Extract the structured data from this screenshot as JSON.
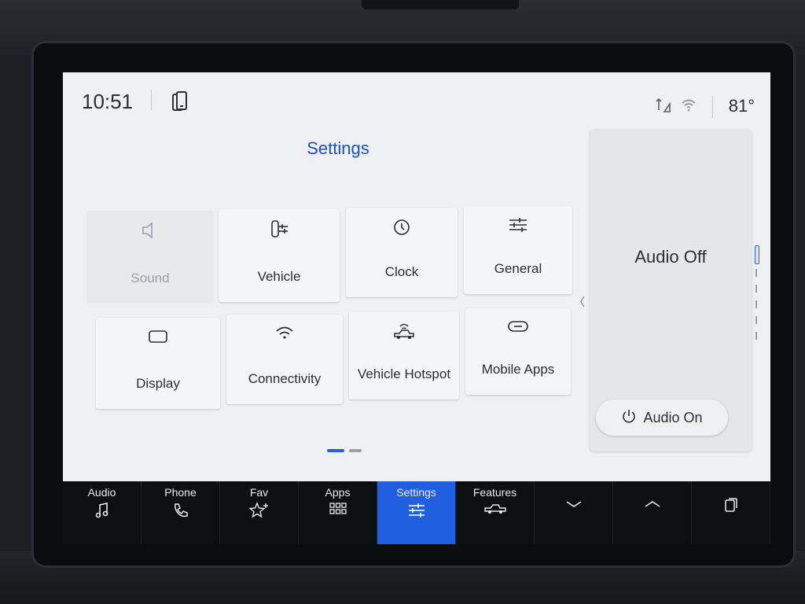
{
  "status": {
    "time": "10:51",
    "temperature": "81°"
  },
  "header": {
    "title": "Settings"
  },
  "tiles": [
    {
      "label": "Sound",
      "icon": "speaker-icon",
      "enabled": false
    },
    {
      "label": "Vehicle",
      "icon": "vehicle-settings-icon",
      "enabled": true
    },
    {
      "label": "Clock",
      "icon": "clock-icon",
      "enabled": true
    },
    {
      "label": "General",
      "icon": "sliders-icon",
      "enabled": true
    },
    {
      "label": "Display",
      "icon": "display-icon",
      "enabled": true
    },
    {
      "label": "Connectivity",
      "icon": "wifi-icon",
      "enabled": true
    },
    {
      "label": "Vehicle Hotspot",
      "icon": "vehicle-hotspot-icon",
      "enabled": true
    },
    {
      "label": "Mobile Apps",
      "icon": "link-icon",
      "enabled": true
    }
  ],
  "pager": {
    "pages": 2,
    "current": 1
  },
  "audio_panel": {
    "status": "Audio Off",
    "button_label": "Audio On"
  },
  "nav": [
    {
      "label": "Audio",
      "icon": "music-note-icon",
      "active": false
    },
    {
      "label": "Phone",
      "icon": "phone-icon",
      "active": false
    },
    {
      "label": "Fav",
      "icon": "star-add-icon",
      "active": false
    },
    {
      "label": "Apps",
      "icon": "apps-grid-icon",
      "active": false
    },
    {
      "label": "Settings",
      "icon": "sliders-icon",
      "active": true
    },
    {
      "label": "Features",
      "icon": "truck-icon",
      "active": false
    },
    {
      "label": "",
      "icon": "chevron-down-icon",
      "active": false
    },
    {
      "label": "",
      "icon": "chevron-up-icon",
      "active": false
    },
    {
      "label": "",
      "icon": "multi-window-icon",
      "active": false
    }
  ],
  "colors": {
    "accent": "#1f5fe0",
    "title_blue": "#1d4fc4",
    "screen_bg": "#eef0f2",
    "nav_bg": "#0e0f11"
  }
}
